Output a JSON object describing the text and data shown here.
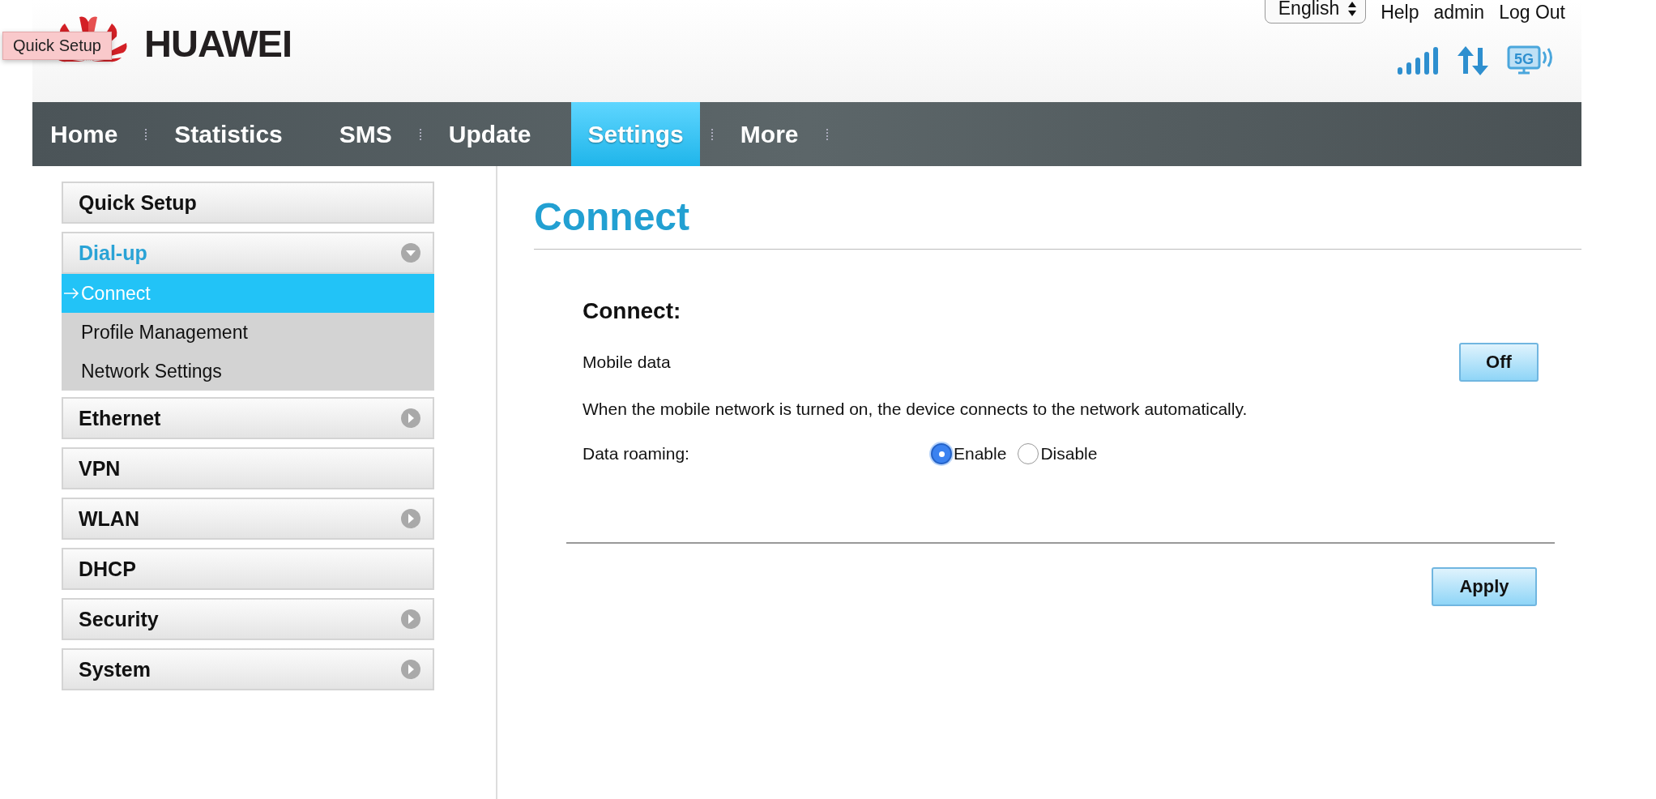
{
  "header": {
    "logo_text": "HUAWEI",
    "language": "English",
    "links": [
      "Help",
      "admin",
      "Log Out"
    ],
    "tooltip": "Quick Setup",
    "network_type": "5G"
  },
  "nav": [
    {
      "label": "Home",
      "selected": false,
      "separator": true
    },
    {
      "label": "Statistics",
      "selected": false,
      "separator": false
    },
    {
      "label": "SMS",
      "selected": false,
      "separator": true
    },
    {
      "label": "Update",
      "selected": false,
      "separator": false
    },
    {
      "label": "Settings",
      "selected": true,
      "separator": true
    },
    {
      "label": "More",
      "selected": false,
      "separator": true
    }
  ],
  "sidebar": {
    "items": [
      {
        "label": "Quick Setup",
        "kind": "plain",
        "selected": false
      },
      {
        "label": "Dial-up",
        "kind": "group",
        "selected": true,
        "expanded": true,
        "children": [
          {
            "label": "Connect",
            "selected": true
          },
          {
            "label": "Profile Management",
            "selected": false
          },
          {
            "label": "Network Settings",
            "selected": false
          }
        ]
      },
      {
        "label": "Ethernet",
        "kind": "group",
        "selected": false,
        "expanded": false
      },
      {
        "label": "VPN",
        "kind": "plain",
        "selected": false
      },
      {
        "label": "WLAN",
        "kind": "group",
        "selected": false,
        "expanded": false
      },
      {
        "label": "DHCP",
        "kind": "plain",
        "selected": false
      },
      {
        "label": "Security",
        "kind": "group",
        "selected": false,
        "expanded": false
      },
      {
        "label": "System",
        "kind": "group",
        "selected": false,
        "expanded": false
      }
    ]
  },
  "content": {
    "title": "Connect",
    "section": "Connect:",
    "mobile_data": {
      "label": "Mobile data",
      "button": "Off"
    },
    "description": "When the mobile network is turned on, the device connects to the network automatically.",
    "roaming": {
      "label": "Data roaming:",
      "options": [
        {
          "label": "Enable",
          "selected": true
        },
        {
          "label": "Disable",
          "selected": false
        }
      ]
    },
    "apply": "Apply"
  }
}
